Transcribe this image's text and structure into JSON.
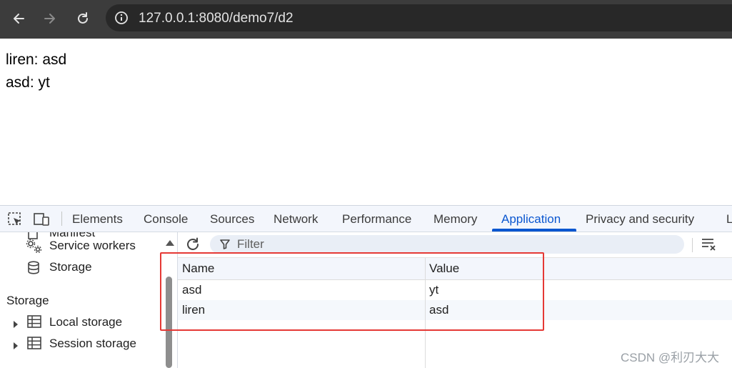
{
  "browser": {
    "url": "127.0.0.1:8080/demo7/d2",
    "icons": [
      "back-arrow-icon",
      "forward-arrow-icon",
      "reload-icon",
      "site-info-icon"
    ]
  },
  "page": {
    "lines": [
      "liren: asd",
      "asd: yt"
    ]
  },
  "devtools": {
    "tabs": [
      "Elements",
      "Console",
      "Sources",
      "Network",
      "Performance",
      "Memory",
      "Application",
      "Privacy and security",
      "L"
    ],
    "active_tab": "Application",
    "accent": "#0b57d0",
    "sidebar": {
      "app_items": [
        "Manifest",
        "Service workers",
        "Storage"
      ],
      "storage_heading": "Storage",
      "storage_items": [
        "Local storage",
        "Session storage"
      ]
    },
    "filter_placeholder": "Filter",
    "table": {
      "columns": [
        "Name",
        "Value"
      ],
      "rows": [
        [
          "asd",
          "yt"
        ],
        [
          "liren",
          "asd"
        ]
      ]
    }
  },
  "highlight_color": "#e53935",
  "watermark": "CSDN @利刃大大"
}
